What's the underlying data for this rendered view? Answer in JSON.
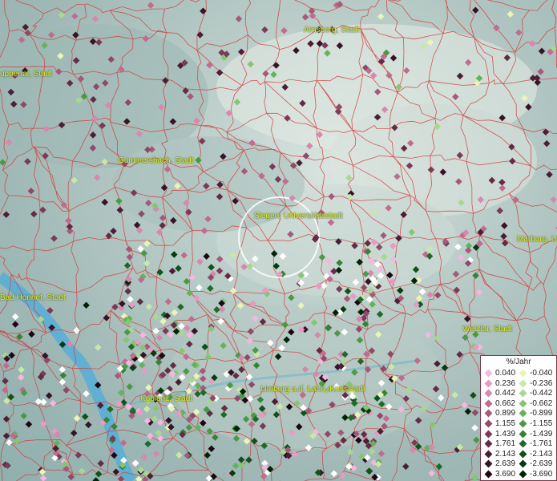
{
  "map": {
    "cities": [
      {
        "id": "arnsberg",
        "name": "Arnsberg, Stadt"
      },
      {
        "id": "wuppertal",
        "name": "uppertal, Stadt"
      },
      {
        "id": "gummersbach",
        "name": "Gummersbach, Stadt"
      },
      {
        "id": "siegen",
        "name": "Siegen, Universitätsstadt"
      },
      {
        "id": "marburg",
        "name": "Marburg, U"
      },
      {
        "id": "badhonnef",
        "name": "Bad Honnef, Stadt"
      },
      {
        "id": "wetzlar",
        "name": "Wetzlar, Stadt"
      },
      {
        "id": "koblenz",
        "name": "Koblenz, Stadt"
      },
      {
        "id": "limburg",
        "name": "Limburg a.d. Lahn, Kreisstadt"
      }
    ],
    "colors": {
      "boundary": "#d23c3c",
      "label": "#e8ec2e",
      "river": "#5aaed6",
      "highlight": "#ffffff"
    }
  },
  "legend": {
    "title": "%/Jahr",
    "positive": [
      {
        "value": "0.040",
        "color": "#f5b6e0"
      },
      {
        "value": "0.236",
        "color": "#e79ac4"
      },
      {
        "value": "0.442",
        "color": "#d987ae"
      },
      {
        "value": "0.662",
        "color": "#c06c8f"
      },
      {
        "value": "0.899",
        "color": "#a65a7a"
      },
      {
        "value": "1.155",
        "color": "#904a69"
      },
      {
        "value": "1.439",
        "color": "#7a3a58"
      },
      {
        "value": "1.761",
        "color": "#622c45"
      },
      {
        "value": "2.143",
        "color": "#4d1d34"
      },
      {
        "value": "2.639",
        "color": "#381226"
      },
      {
        "value": "3.690",
        "color": "#1e0612"
      }
    ],
    "negative": [
      {
        "value": "-0.040",
        "color": "#e8f5b3"
      },
      {
        "value": "-0.236",
        "color": "#c8e8a6"
      },
      {
        "value": "-0.442",
        "color": "#a8d890"
      },
      {
        "value": "-0.662",
        "color": "#86c672"
      },
      {
        "value": "-0.899",
        "color": "#66b25a"
      },
      {
        "value": "-1.155",
        "color": "#4a9a44"
      },
      {
        "value": "-1.439",
        "color": "#348434"
      },
      {
        "value": "-1.761",
        "color": "#1f6a26"
      },
      {
        "value": "-2.143",
        "color": "#10521a"
      },
      {
        "value": "-2.639",
        "color": "#063a10"
      },
      {
        "value": "-3.690",
        "color": "#022406"
      }
    ]
  }
}
